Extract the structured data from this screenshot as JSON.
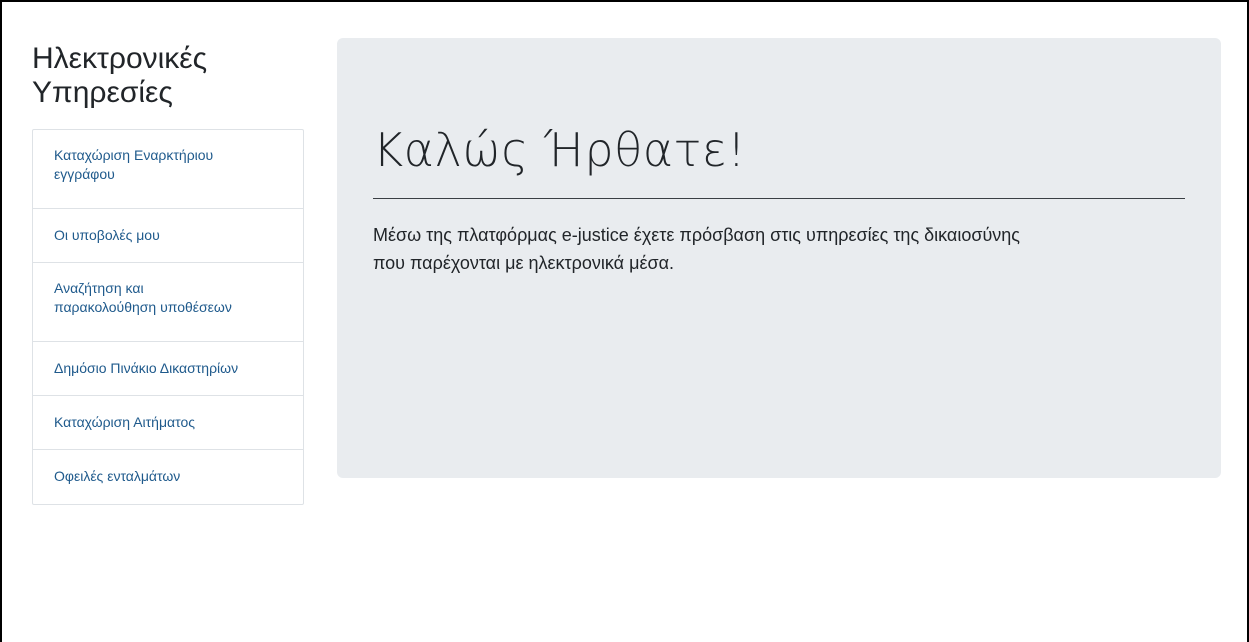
{
  "sidebar": {
    "title_line1": "Ηλεκτρονικές",
    "title_line2": "Υπηρεσίες",
    "items": [
      {
        "label_line1": "Καταχώριση Εναρκτήριου",
        "label_line2": "εγγράφου"
      },
      {
        "label_line1": "Οι υποβολές μου",
        "label_line2": ""
      },
      {
        "label_line1": "Αναζήτηση και",
        "label_line2": "παρακολούθηση υποθέσεων"
      },
      {
        "label_line1": "Δημόσιο Πινάκιο Δικαστηρίων",
        "label_line2": ""
      },
      {
        "label_line1": "Καταχώριση Αιτήματος",
        "label_line2": ""
      },
      {
        "label_line1": "Οφειλές ενταλμάτων",
        "label_line2": ""
      }
    ]
  },
  "main": {
    "welcome_title": "Καλώς Ήρθατε!",
    "lead_line1": "Μέσω της πλατφόρμας e-justice έχετε πρόσβαση στις υπηρεσίες της δικαιοσύνης",
    "lead_line2": "που παρέχονται με ηλεκτρονικά μέσα."
  },
  "colors": {
    "link": "#1f5a8c",
    "jumbotron_bg": "#e9ecef",
    "text": "#212529"
  }
}
